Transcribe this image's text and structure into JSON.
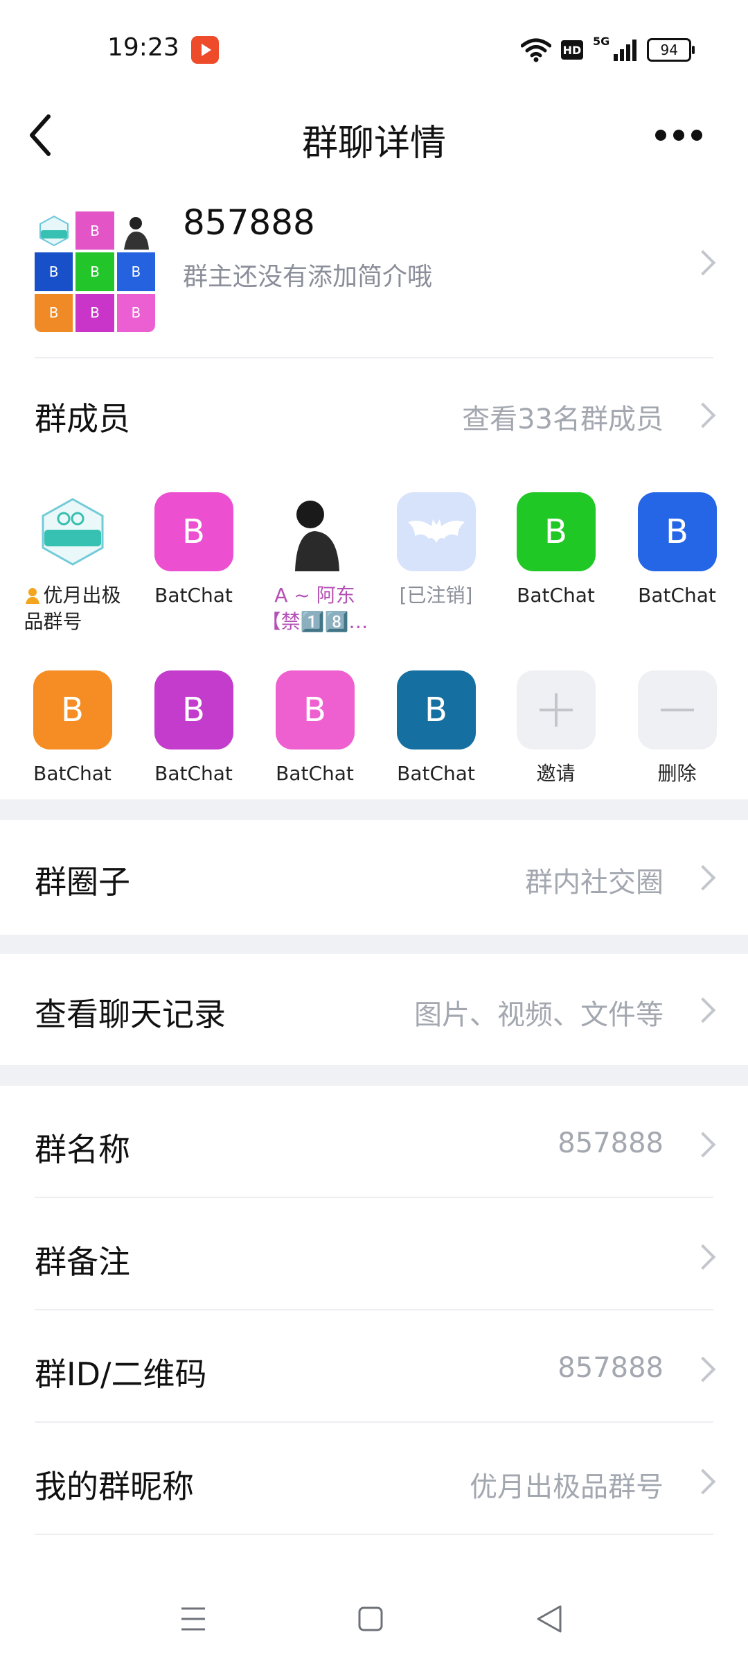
{
  "status_bar": {
    "time": "19:23",
    "network_label": "5G",
    "hd_label": "HD",
    "battery": "94"
  },
  "header": {
    "title": "群聊详情",
    "back_icon": "chevron-left-icon",
    "more_icon": "more-horizontal-icon"
  },
  "group": {
    "name": "857888",
    "description": "群主还没有添加简介哦",
    "avatar_tiles": [
      {
        "color": "#ffffff",
        "text": ""
      },
      {
        "color": "#e354c6",
        "text": "B"
      },
      {
        "color": "#ffffff",
        "text": ""
      },
      {
        "color": "#1750c8",
        "text": "B"
      },
      {
        "color": "#22c52a",
        "text": "B"
      },
      {
        "color": "#2462e0",
        "text": "B"
      },
      {
        "color": "#f08a26",
        "text": "B"
      },
      {
        "color": "#c935c9",
        "text": "B"
      },
      {
        "color": "#ec5fd2",
        "text": "B"
      }
    ]
  },
  "members_section": {
    "label": "群成员",
    "link": "查看33名群成员",
    "members": [
      {
        "name": "优月出极品群号",
        "owner": true,
        "avatar": "qq-badge",
        "color": "#ffffff",
        "letter": ""
      },
      {
        "name": "BatChat",
        "avatar": "letter",
        "color": "#ec4fd0",
        "letter": "B"
      },
      {
        "name": "A ~ 阿东【禁1️⃣8️⃣…",
        "avatar": "photo",
        "color": "#ffffff",
        "letter": ""
      },
      {
        "name": "[已注销]",
        "avatar": "bat",
        "color": "#d7e3fb",
        "letter": ""
      },
      {
        "name": "BatChat",
        "avatar": "letter",
        "color": "#20c825",
        "letter": "B"
      },
      {
        "name": "BatChat",
        "avatar": "letter",
        "color": "#2566e6",
        "letter": "B"
      },
      {
        "name": "BatChat",
        "avatar": "letter",
        "color": "#f58d24",
        "letter": "B"
      },
      {
        "name": "BatChat",
        "avatar": "letter",
        "color": "#c43ccc",
        "letter": "B"
      },
      {
        "name": "BatChat",
        "avatar": "letter",
        "color": "#ee5fcf",
        "letter": "B"
      },
      {
        "name": "BatChat",
        "avatar": "letter",
        "color": "#156fa0",
        "letter": "B"
      }
    ],
    "invite_label": "邀请",
    "remove_label": "删除"
  },
  "circle_row": {
    "label": "群圈子",
    "value": "群内社交圈"
  },
  "history_row": {
    "label": "查看聊天记录",
    "value": "图片、视频、文件等"
  },
  "settings_rows": [
    {
      "label": "群名称",
      "value": "857888"
    },
    {
      "label": "群备注",
      "value": ""
    },
    {
      "label": "群ID/二维码",
      "value": "857888"
    },
    {
      "label": "我的群昵称",
      "value": "优月出极品群号"
    }
  ],
  "nav_bar": {
    "menu_icon": "menu-icon",
    "home_icon": "square-home-icon",
    "back_icon": "triangle-back-icon"
  }
}
